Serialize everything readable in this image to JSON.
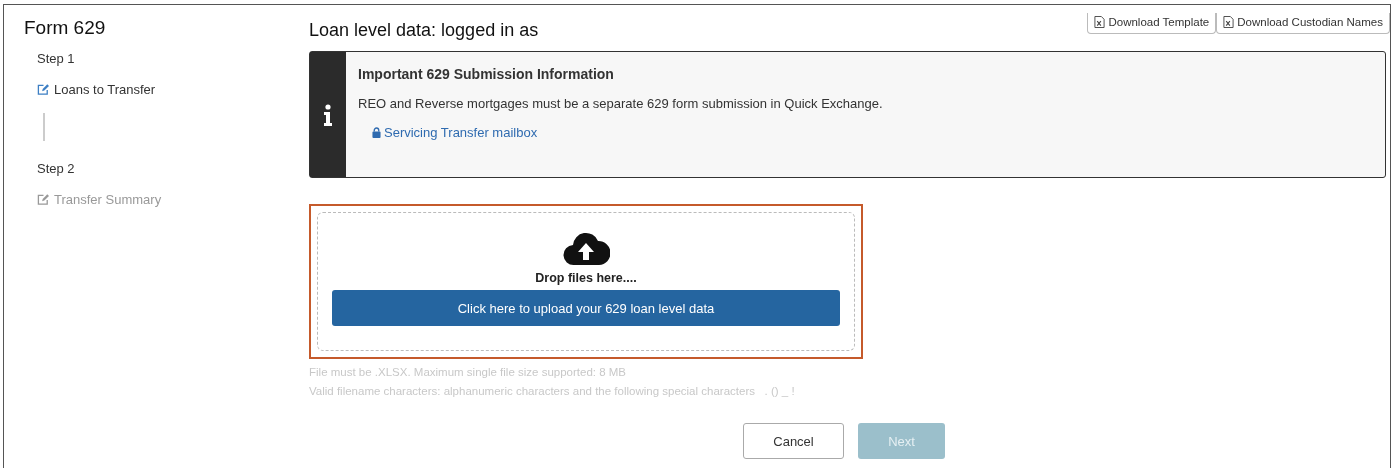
{
  "form_title": "Form 629",
  "steps": [
    {
      "label": "Step 1",
      "item": "Loans to Transfer",
      "disabled": false
    },
    {
      "label": "Step 2",
      "item": "Transfer Summary",
      "disabled": true
    }
  ],
  "page_title": "Loan level data: logged in as",
  "downloads": [
    "Download Template",
    "Download Custodian Names"
  ],
  "notice": {
    "title": "Important 629 Submission Information",
    "text": "REO and Reverse mortgages must be a separate 629 form submission in Quick Exchange.",
    "link": "Servicing Transfer mailbox"
  },
  "upload": {
    "drop_text": "Drop files here....",
    "button": "Click here to upload your 629 loan level data",
    "highlighted": true
  },
  "hints": [
    "File must be .XLSX. Maximum single file size supported: 8 MB",
    "Valid filename characters: alphanumeric characters and the following special characters   . () _ !"
  ],
  "buttons": [
    {
      "label": "Cancel",
      "kind": "secondary",
      "disabled": false
    },
    {
      "label": "Next",
      "kind": "primary",
      "disabled": true
    }
  ]
}
